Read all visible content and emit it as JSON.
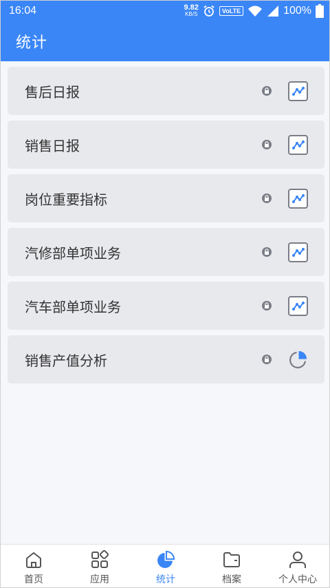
{
  "status_bar": {
    "time": "16:04",
    "net_speed_value": "9.82",
    "net_speed_unit": "KB/S",
    "volte": "VoLTE",
    "battery": "100%"
  },
  "header": {
    "title": "统计"
  },
  "list": {
    "items": [
      {
        "label": "售后日报",
        "icon": "line-chart-icon"
      },
      {
        "label": "销售日报",
        "icon": "line-chart-icon"
      },
      {
        "label": "岗位重要指标",
        "icon": "line-chart-icon"
      },
      {
        "label": "汽修部单项业务",
        "icon": "line-chart-icon"
      },
      {
        "label": "汽车部单项业务",
        "icon": "line-chart-icon"
      },
      {
        "label": "销售产值分析",
        "icon": "pie-chart-icon"
      }
    ]
  },
  "bottom_nav": {
    "items": [
      {
        "label": "首页",
        "icon": "home-icon"
      },
      {
        "label": "应用",
        "icon": "apps-icon"
      },
      {
        "label": "统计",
        "icon": "pie-chart-icon",
        "active": true
      },
      {
        "label": "档案",
        "icon": "folder-icon"
      },
      {
        "label": "个人中心",
        "icon": "user-icon"
      }
    ]
  },
  "colors": {
    "primary": "#3a86f7",
    "item_bg": "#e8e9ed",
    "icon_gray": "#7a7d86"
  }
}
